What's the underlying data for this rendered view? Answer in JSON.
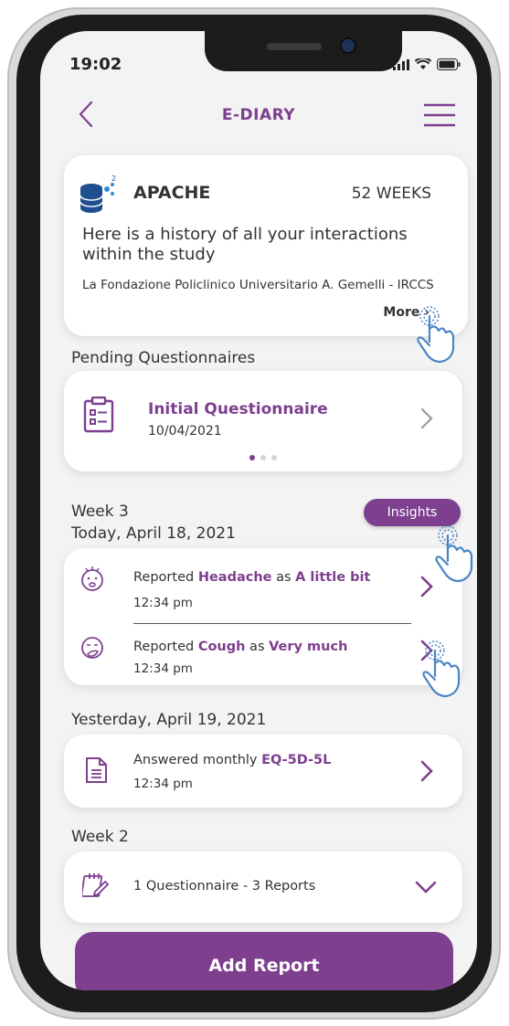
{
  "status_bar": {
    "time": "19:02"
  },
  "header": {
    "title": "E-DIARY"
  },
  "study": {
    "name": "APACHE",
    "weeks": "52 WEEKS",
    "description": "Here is a history of all your interactions within the study",
    "institution": "La Fondazione Policlinico Universitario A. Gemelli - IRCCS",
    "more_label": "More"
  },
  "pending": {
    "section_label": "Pending Questionnaires",
    "title": "Initial Questionnaire",
    "date": "10/04/2021"
  },
  "week3": {
    "label": "Week 3",
    "day_label": "Today, April 18, 2021",
    "insights_label": "Insights",
    "rows": [
      {
        "prefix": "Reported ",
        "symptom": "Headache",
        "middle": " as ",
        "level": "A little bit",
        "time": "12:34 pm"
      },
      {
        "prefix": "Reported ",
        "symptom": "Cough",
        "middle": " as ",
        "level": "Very much",
        "time": "12:34 pm"
      }
    ]
  },
  "yesterday": {
    "day_label": "Yesterday, April 19, 2021",
    "prefix": "Answered monthly ",
    "questionnaire": "EQ-5D-5L",
    "time": "12:34 pm"
  },
  "week2": {
    "label": "Week 2",
    "summary": "1 Questionnaire - 3 Reports"
  },
  "add_report_label": "Add Report",
  "colors": {
    "accent": "#7e3f8f",
    "background": "#f3f3f3",
    "hand": "#4a86c5"
  }
}
